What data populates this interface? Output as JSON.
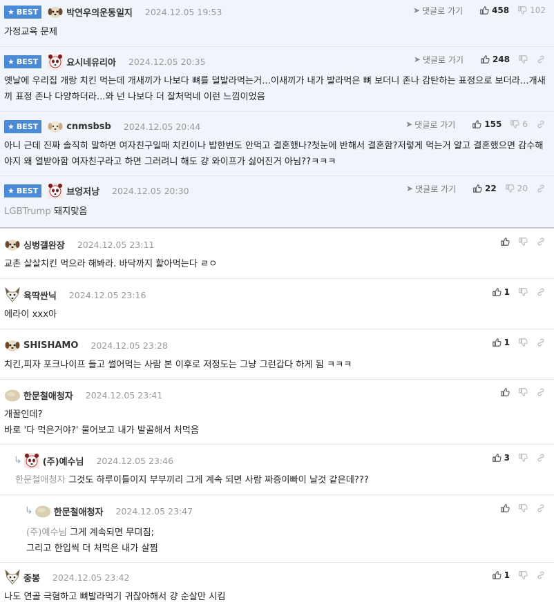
{
  "best_label": "BEST",
  "reply_link_label": "댓글로 가기",
  "best_comments": [
    {
      "nick": "박연우의운동일지",
      "date": "2024.12.05 19:53",
      "likes": "458",
      "dislikes": "102",
      "text": "가정교육 문제",
      "mention": "",
      "avatar": "dog"
    },
    {
      "nick": "요시네유리아",
      "date": "2024.12.05 20:35",
      "likes": "248",
      "dislikes": "",
      "text": "옛날에 우리집 개랑 치킨 먹는데 개새끼가 나보다 뼈를 덜발라먹는거...이새끼가 내가 발라먹은 뼈 보더니 존나 감탄하는 표정으로 보더라...개새끼 표정 존나 다양하더라...와 넌 나보다 더 잘처먹네 이런 느낌이었음",
      "mention": "",
      "avatar": "panda"
    },
    {
      "nick": "cnmsbsb",
      "date": "2024.12.05 20:44",
      "likes": "155",
      "dislikes": "6",
      "text": "아니 근데 진짜 솔직히 말하면 여자친구일때 치킨이나 밥한번도 안먹고 결혼했나?첫눈에 반해서 결혼함?저렇게 먹는거 알고 결혼했으면 감수해야지 왜 열받아함 여자친구라고 하면 그러려니 해도 걍 와이프가 싫어진거 아님??ㅋㅋㅋ",
      "mention": "",
      "avatar": "dog-light"
    },
    {
      "nick": "브엉저낭",
      "date": "2024.12.05 20:30",
      "likes": "22",
      "dislikes": "20",
      "text": "돼지맞음",
      "mention": "LGBTrump",
      "avatar": "panda"
    }
  ],
  "comments": [
    {
      "nick": "싱벙갤완장",
      "date": "2024.12.05 23:11",
      "likes": "",
      "lines": [
        "교촌 살살치킨 먹으라 해봐라. 바닥까지 핥아먹는다 ㄹㅇ"
      ],
      "mention": "",
      "avatar": "dog",
      "depth": 0
    },
    {
      "nick": "육딱싼닉",
      "date": "2024.12.05 23:16",
      "likes": "1",
      "lines": [
        "에라이 xxx아"
      ],
      "mention": "",
      "avatar": "fox",
      "depth": 0
    },
    {
      "nick": "SHISHAMO",
      "date": "2024.12.05 23:28",
      "likes": "1",
      "lines": [
        "치킨,피자 포크나이프 들고 썰어먹는 사람 본 이후로 저정도는 그냥 그런갑다 하게 됨 ㅋㅋㅋ"
      ],
      "mention": "",
      "avatar": "dog",
      "depth": 0
    },
    {
      "nick": "한문철애청자",
      "date": "2024.12.05 23:41",
      "likes": "",
      "lines": [
        "개꿀인데?",
        "바로 '다 먹은거야?' 물어보고 내가 발골해서 처먹음"
      ],
      "mention": "",
      "avatar": "potato",
      "depth": 0
    },
    {
      "nick": "(주)예수님",
      "date": "2024.12.05 23:46",
      "likes": "3",
      "lines": [
        "그것도 하루이틀이지 부부끼리 그게 계속 되면 사람 짜증이빠이 날것 같은데???"
      ],
      "mention": "한문철애청자",
      "avatar": "panda",
      "depth": 1
    },
    {
      "nick": "한문철애청자",
      "date": "2024.12.05 23:47",
      "likes": "",
      "lines": [
        "그게 계속되면 무뎌짐;",
        "그리고 한입씩 더 처먹은 내가 살찜"
      ],
      "mention": "(주)예수님",
      "avatar": "potato",
      "depth": 2
    },
    {
      "nick": "중봉",
      "date": "2024.12.05 23:42",
      "likes": "1",
      "lines": [
        "나도 연골 극혐하고 뼈발라먹기 귀찮아해서 걍 순살만 시킴"
      ],
      "mention": "",
      "avatar": "fox",
      "depth": 0
    }
  ]
}
